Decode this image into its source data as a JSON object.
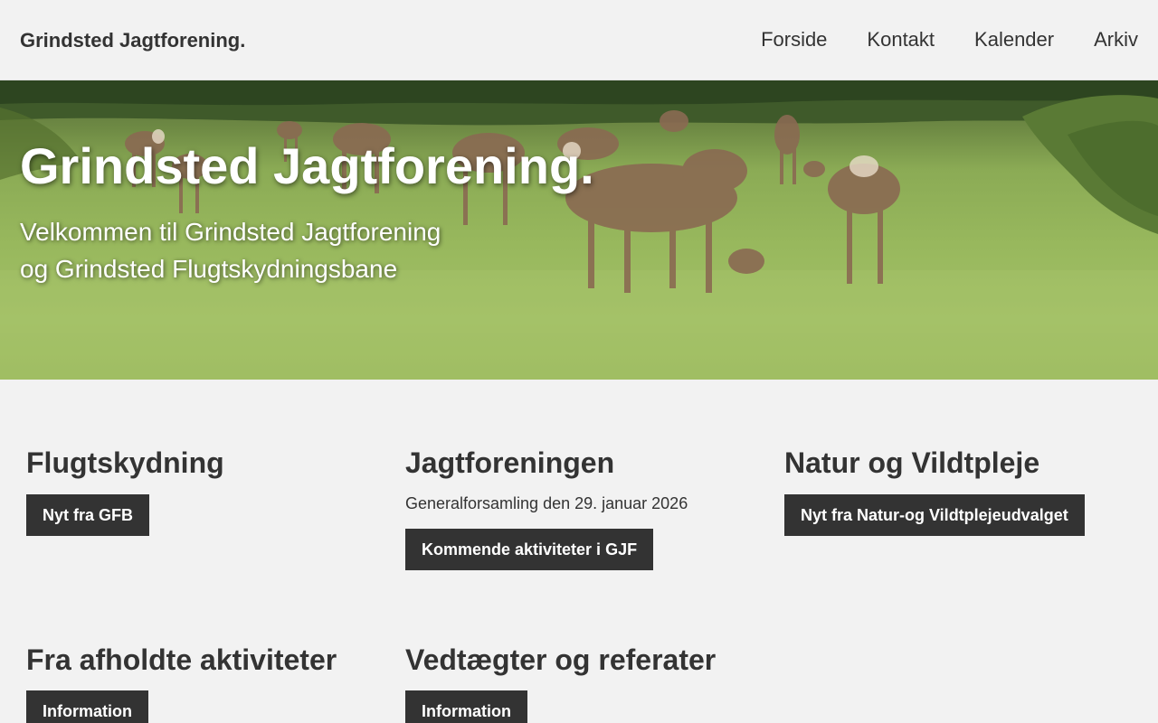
{
  "header": {
    "brand": "Grindsted Jagtforening.",
    "nav": [
      "Forside",
      "Kontakt",
      "Kalender",
      "Arkiv"
    ]
  },
  "hero": {
    "title": "Grindsted Jagtforening.",
    "subtitle_line1": "Velkommen til Grindsted Jagtforening",
    "subtitle_line2": "og Grindsted Flugtskydningsbane",
    "image_icon": "deer-meadow-photo"
  },
  "sections": [
    {
      "title": "Flugtskydning",
      "text": "",
      "button": "Nyt fra GFB"
    },
    {
      "title": "Jagtforeningen",
      "text": "Generalforsamling den 29. januar 2026",
      "button": "Kommende aktiviteter i GJF"
    },
    {
      "title": "Natur og Vildtpleje",
      "text": "",
      "button": "Nyt fra Natur-og Vildtplejeudvalget"
    },
    {
      "title": "Fra afholdte aktiviteter",
      "text": "",
      "button": "Information"
    },
    {
      "title": "Vedtægter og referater",
      "text": "",
      "button": "Information"
    }
  ],
  "colors": {
    "background": "#f2f2f2",
    "button": "#333333",
    "text": "#333333"
  }
}
